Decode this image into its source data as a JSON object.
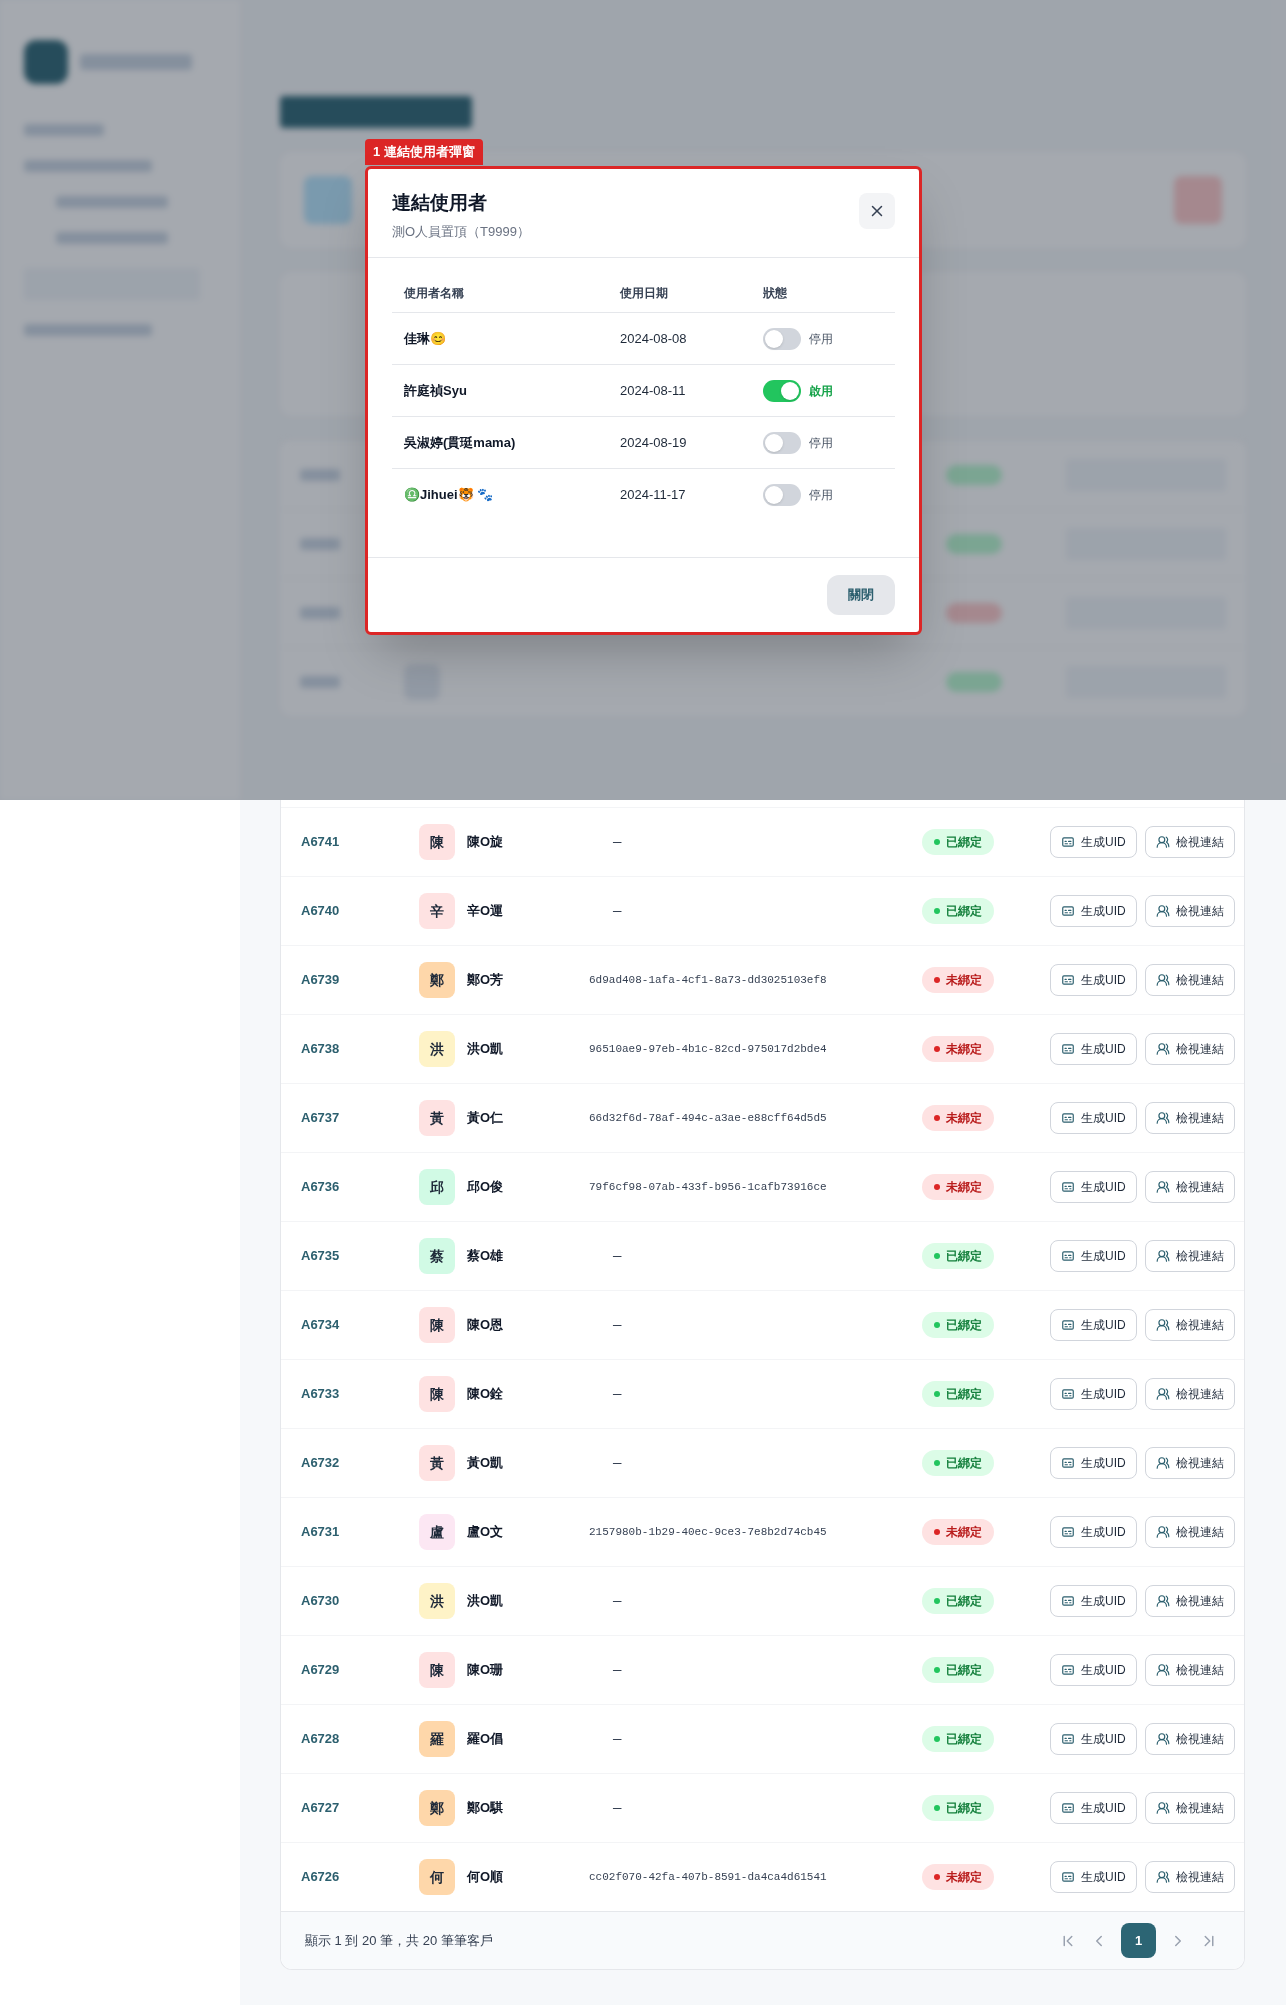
{
  "annotation": {
    "label": "1 連結使用者彈窗"
  },
  "modal": {
    "title": "連結使用者",
    "subtitle": "測O人員置頂（T9999）",
    "columns": [
      "使用者名稱",
      "使用日期",
      "狀態"
    ],
    "rows": [
      {
        "name": "佳琳😊",
        "date": "2024-08-08",
        "on": false,
        "status": "停用"
      },
      {
        "name": "許庭禎Syu",
        "date": "2024-08-11",
        "on": true,
        "status": "啟用"
      },
      {
        "name": "吳淑婷(貫珽mama)",
        "date": "2024-08-19",
        "on": false,
        "status": "停用"
      },
      {
        "name": "♎Jihuei🐯 🐾",
        "date": "2024-11-17",
        "on": false,
        "status": "停用"
      }
    ],
    "close_button": "關閉"
  },
  "table": {
    "rows": [
      {
        "id": "A6741",
        "avatar": "陳",
        "color": "#fee2e2",
        "name": "陳O旋",
        "uid": "—",
        "bound": true,
        "status": "已綁定",
        "actions": [
          "生成UID",
          "檢視連結"
        ]
      },
      {
        "id": "A6740",
        "avatar": "辛",
        "color": "#fee2e2",
        "name": "辛O運",
        "uid": "—",
        "bound": true,
        "status": "已綁定",
        "actions": [
          "生成UID",
          "檢視連結"
        ]
      },
      {
        "id": "A6739",
        "avatar": "鄭",
        "color": "#fed7aa",
        "name": "鄭O芳",
        "uid": "6d9ad408-1afa-4cf1-8a73-dd3025103ef8",
        "bound": false,
        "status": "未綁定",
        "actions": [
          "生成UID",
          "檢視連結"
        ]
      },
      {
        "id": "A6738",
        "avatar": "洪",
        "color": "#fef3c7",
        "name": "洪O凱",
        "uid": "96510ae9-97eb-4b1c-82cd-975017d2bde4",
        "bound": false,
        "status": "未綁定",
        "actions": [
          "生成UID",
          "檢視連結"
        ]
      },
      {
        "id": "A6737",
        "avatar": "黃",
        "color": "#fee2e2",
        "name": "黃O仁",
        "uid": "66d32f6d-78af-494c-a3ae-e88cff64d5d5",
        "bound": false,
        "status": "未綁定",
        "actions": [
          "生成UID",
          "檢視連結"
        ]
      },
      {
        "id": "A6736",
        "avatar": "邱",
        "color": "#d1fae5",
        "name": "邱O俊",
        "uid": "79f6cf98-07ab-433f-b956-1cafb73916ce",
        "bound": false,
        "status": "未綁定",
        "actions": [
          "生成UID",
          "檢視連結"
        ]
      },
      {
        "id": "A6735",
        "avatar": "蔡",
        "color": "#d1fae5",
        "name": "蔡O雄",
        "uid": "—",
        "bound": true,
        "status": "已綁定",
        "actions": [
          "生成UID",
          "檢視連結"
        ]
      },
      {
        "id": "A6734",
        "avatar": "陳",
        "color": "#fee2e2",
        "name": "陳O恩",
        "uid": "—",
        "bound": true,
        "status": "已綁定",
        "actions": [
          "生成UID",
          "檢視連結"
        ]
      },
      {
        "id": "A6733",
        "avatar": "陳",
        "color": "#fee2e2",
        "name": "陳O銓",
        "uid": "—",
        "bound": true,
        "status": "已綁定",
        "actions": [
          "生成UID",
          "檢視連結"
        ]
      },
      {
        "id": "A6732",
        "avatar": "黃",
        "color": "#fee2e2",
        "name": "黃O凱",
        "uid": "—",
        "bound": true,
        "status": "已綁定",
        "actions": [
          "生成UID",
          "檢視連結"
        ]
      },
      {
        "id": "A6731",
        "avatar": "盧",
        "color": "#fce7f3",
        "name": "盧O文",
        "uid": "2157980b-1b29-40ec-9ce3-7e8b2d74cb45",
        "bound": false,
        "status": "未綁定",
        "actions": [
          "生成UID",
          "檢視連結"
        ]
      },
      {
        "id": "A6730",
        "avatar": "洪",
        "color": "#fef3c7",
        "name": "洪O凱",
        "uid": "—",
        "bound": true,
        "status": "已綁定",
        "actions": [
          "生成UID",
          "檢視連結"
        ]
      },
      {
        "id": "A6729",
        "avatar": "陳",
        "color": "#fee2e2",
        "name": "陳O珊",
        "uid": "—",
        "bound": true,
        "status": "已綁定",
        "actions": [
          "生成UID",
          "檢視連結"
        ]
      },
      {
        "id": "A6728",
        "avatar": "羅",
        "color": "#fed7aa",
        "name": "羅O倡",
        "uid": "—",
        "bound": true,
        "status": "已綁定",
        "actions": [
          "生成UID",
          "檢視連結"
        ]
      },
      {
        "id": "A6727",
        "avatar": "鄭",
        "color": "#fed7aa",
        "name": "鄭O騏",
        "uid": "—",
        "bound": true,
        "status": "已綁定",
        "actions": [
          "生成UID",
          "檢視連結"
        ]
      },
      {
        "id": "A6726",
        "avatar": "何",
        "color": "#fed7aa",
        "name": "何O順",
        "uid": "cc02f070-42fa-407b-8591-da4ca4d61541",
        "bound": false,
        "status": "未綁定",
        "actions": [
          "生成UID",
          "檢視連結"
        ]
      }
    ]
  },
  "footer": {
    "summary": "顯示 1 到 20 筆，共 20 筆筆客戶",
    "pages": [
      {
        "label": "1",
        "selected": true
      }
    ]
  }
}
